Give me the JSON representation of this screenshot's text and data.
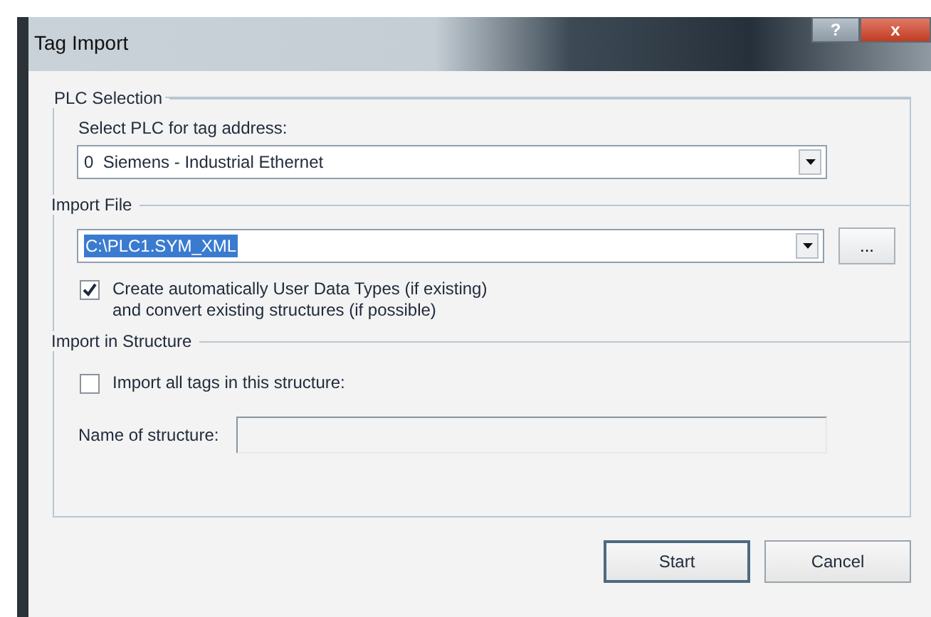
{
  "window": {
    "title": "Tag Import",
    "title_buttons": [
      "?",
      "x"
    ]
  },
  "sections": [
    {
      "kind": "plc",
      "title": "PLC Selection",
      "label": "Select PLC for tag address:",
      "combo_value": "0  Siemens - Industrial Ethernet"
    },
    {
      "kind": "file",
      "title": "Import File",
      "combo_value": "C:\\PLC1.SYM_XML",
      "browse_button": "...",
      "checkbox": {
        "label": "Create automatically User Data Types (if existing)\nand convert existing structures (if possible)",
        "checked": true
      }
    },
    {
      "kind": "structure",
      "title": "Import in Structure",
      "checkbox": {
        "label": "Import all tags in this structure:",
        "checked": false
      },
      "name_label": "Name of structure:"
    }
  ],
  "buttons": [
    {
      "label": "Start",
      "default": true
    },
    {
      "label": "Cancel",
      "default": false
    }
  ]
}
